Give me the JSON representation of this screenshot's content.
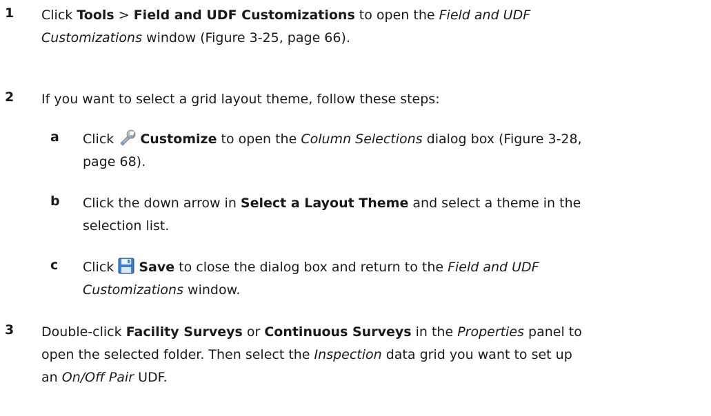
{
  "steps": [
    {
      "number": "1",
      "parts": {
        "p1": "Click ",
        "b1": "Tools",
        "p2": " > ",
        "b2": "Field and UDF Customizations",
        "p3": " to open the ",
        "i1": "Field and UDF",
        "i2": "Customizations",
        "p4": " window (Figure 3-25, page 66)."
      }
    },
    {
      "number": "2",
      "parts": {
        "p1": "If you want to select a grid layout theme, follow these steps:"
      },
      "substeps": [
        {
          "letter": "a",
          "parts": {
            "p1": "Click ",
            "icon": "wrench-icon",
            "b1": "Customize",
            "p2": " to open the ",
            "i1": "Column Selections",
            "p3": " dialog box (Figure 3-28,",
            "p4": "page 68)."
          }
        },
        {
          "letter": "b",
          "parts": {
            "p1": "Click the down arrow in ",
            "b1": "Select a Layout Theme",
            "p2": " and select a theme in the",
            "p3": "selection list."
          }
        },
        {
          "letter": "c",
          "parts": {
            "p1": "Click ",
            "icon": "save-icon",
            "b1": "Save",
            "p2": " to close the dialog box and return to the ",
            "i1": "Field and UDF",
            "i2": "Customizations",
            "p3": " window."
          }
        }
      ]
    },
    {
      "number": "3",
      "parts": {
        "p1": "Double-click ",
        "b1": "Facility Surveys",
        "p2": " or ",
        "b2": "Continuous Surveys",
        "p3": " in the ",
        "i1": "Properties",
        "p4": " panel to",
        "p5": "open the selected folder. Then select the ",
        "i2": "Inspection",
        "p6": " data grid you want to set up",
        "p7": "an ",
        "i3": "On/Off Pair",
        "p8": " UDF."
      }
    }
  ]
}
